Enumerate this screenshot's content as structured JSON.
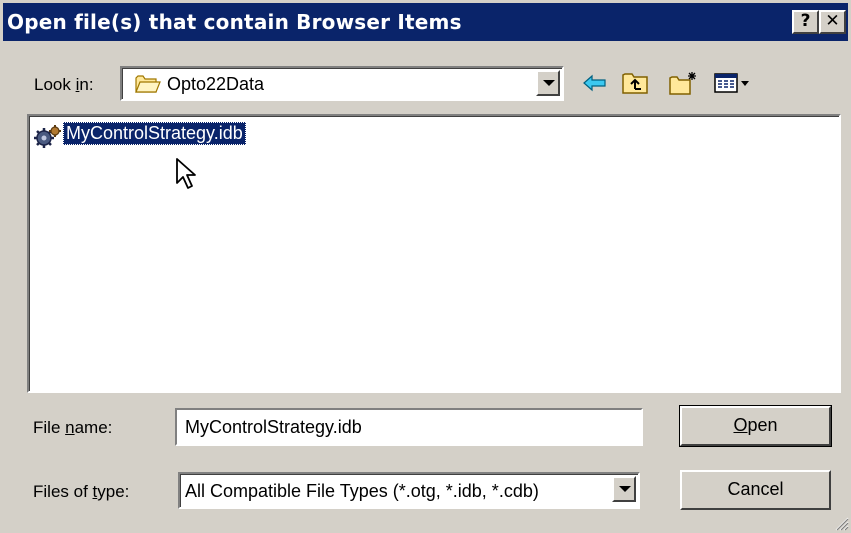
{
  "window": {
    "title": "Open file(s) that contain Browser Items",
    "help_label": "?",
    "close_label": "✕"
  },
  "look_in": {
    "label_pre": "Look ",
    "label_key": "i",
    "label_post": "n:",
    "value": "Opto22Data"
  },
  "toolbar": {
    "icons": [
      "back-arrow-icon",
      "up-folder-icon",
      "new-folder-icon",
      "view-menu-icon"
    ]
  },
  "files": [
    {
      "name": "MyControlStrategy.idb",
      "icon": "gear-document-icon",
      "selected": true
    }
  ],
  "file_name": {
    "label_pre": "File ",
    "label_key": "n",
    "label_post": "ame:",
    "value": "MyControlStrategy.idb"
  },
  "file_type": {
    "label_pre": "Files of ",
    "label_key": "t",
    "label_post": "ype:",
    "value": "All Compatible File Types (*.otg, *.idb, *.cdb)"
  },
  "buttons": {
    "open_key": "O",
    "open_rest": "pen",
    "cancel": "Cancel"
  },
  "colors": {
    "title_bar": "#0a246a",
    "face": "#d4d0c8",
    "selection": "#0a246a"
  }
}
